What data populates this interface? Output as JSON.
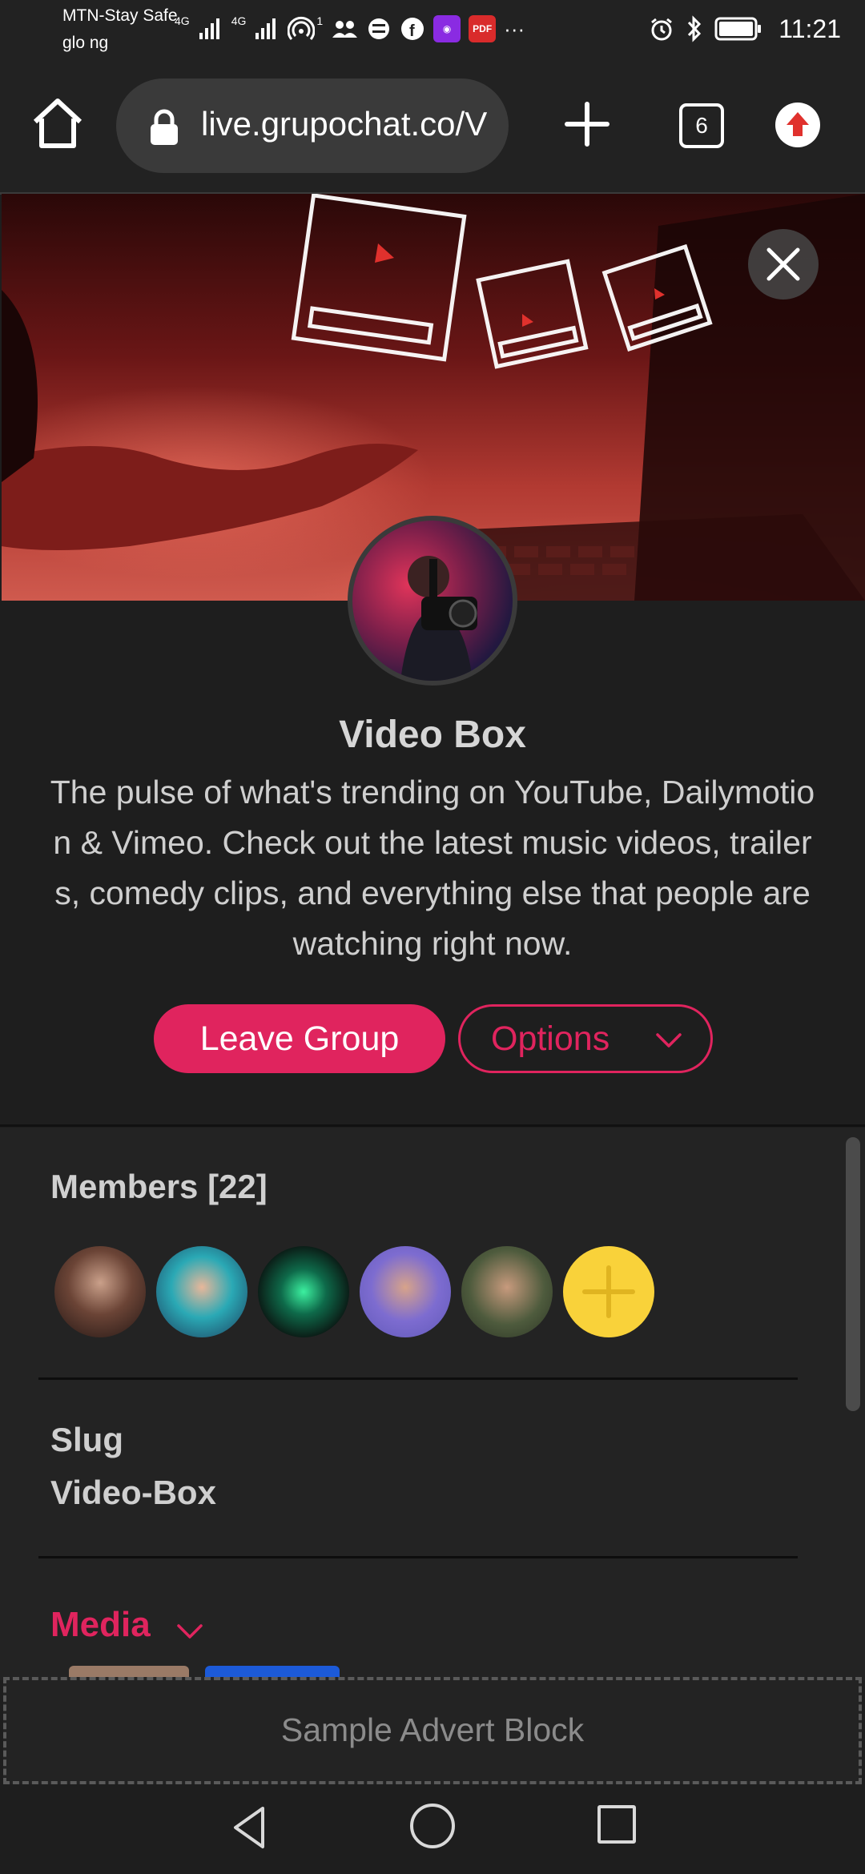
{
  "status_bar": {
    "carrier_line1": "MTN-Stay Safe",
    "carrier_line2": "glo ng",
    "net1": "4G",
    "net2": "4G",
    "hotspot_count": "1",
    "pdf_badge": "PDF",
    "more": "···",
    "time": "11:21",
    "icons": [
      "signal-icon",
      "hotspot-icon",
      "contacts-icon",
      "vpn-icon",
      "facebook-icon",
      "app-icon",
      "pdf-icon",
      "alarm-icon",
      "bluetooth-icon",
      "battery-icon"
    ]
  },
  "browser": {
    "url": "live.grupochat.co/V",
    "tab_count": "6",
    "update_color": "#e0312d"
  },
  "group": {
    "title": "Video Box",
    "description": "The pulse of what's trending on YouTube, Dailymotion & Vimeo. Check out the latest music videos, trailers, comedy clips, and everything else that people are watching right now.",
    "leave_label": "Leave Group",
    "options_label": "Options"
  },
  "members": {
    "label": "Members [22]",
    "avatar_names": [
      "member-avatar-1",
      "member-avatar-2",
      "member-avatar-3",
      "member-avatar-4",
      "member-avatar-5"
    ]
  },
  "slug": {
    "label": "Slug",
    "value": "Video-Box"
  },
  "media": {
    "label": "Media"
  },
  "advert": {
    "label": "Sample Advert Block"
  },
  "theme": {
    "accent": "#e0245e",
    "add_member_color": "#f9d23a",
    "background": "#1e1e1e"
  }
}
